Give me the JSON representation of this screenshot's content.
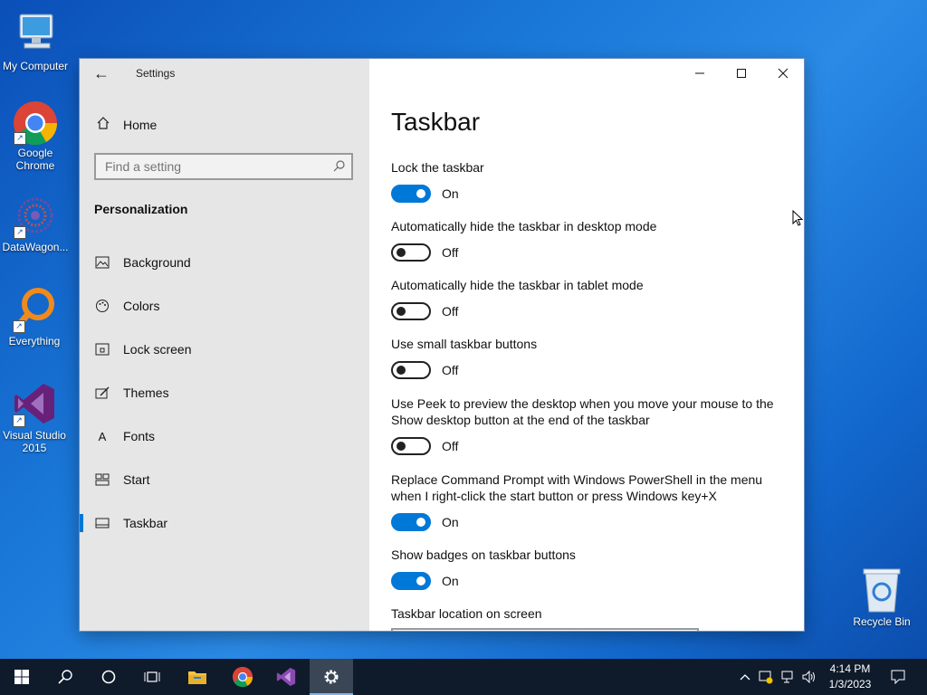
{
  "desktop": {
    "icons": [
      {
        "label": "My Computer"
      },
      {
        "label": "Google Chrome"
      },
      {
        "label": "DataWagon..."
      },
      {
        "label": "Everything"
      },
      {
        "label": "Visual Studio 2015"
      },
      {
        "label": "Recycle Bin"
      }
    ]
  },
  "window": {
    "title": "Settings",
    "controls": {
      "minimize": "—",
      "maximize": "☐",
      "close": "✕"
    }
  },
  "sidebar": {
    "home_label": "Home",
    "search_placeholder": "Find a setting",
    "section_title": "Personalization",
    "items": [
      {
        "label": "Background",
        "icon": "background-icon"
      },
      {
        "label": "Colors",
        "icon": "colors-icon"
      },
      {
        "label": "Lock screen",
        "icon": "lock-screen-icon"
      },
      {
        "label": "Themes",
        "icon": "themes-icon"
      },
      {
        "label": "Fonts",
        "icon": "fonts-icon"
      },
      {
        "label": "Start",
        "icon": "start-icon"
      },
      {
        "label": "Taskbar",
        "icon": "taskbar-icon",
        "active": true
      }
    ]
  },
  "main": {
    "page_title": "Taskbar",
    "settings": [
      {
        "label": "Lock the taskbar",
        "state": "On"
      },
      {
        "label": "Automatically hide the taskbar in desktop mode",
        "state": "Off"
      },
      {
        "label": "Automatically hide the taskbar in tablet mode",
        "state": "Off"
      },
      {
        "label": "Use small taskbar buttons",
        "state": "Off"
      },
      {
        "label": "Use Peek to preview the desktop when you move your mouse to the Show desktop button at the end of the taskbar",
        "state": "Off"
      },
      {
        "label": "Replace Command Prompt with Windows PowerShell in the menu when I right-click the start button or press Windows key+X",
        "state": "On"
      },
      {
        "label": "Show badges on taskbar buttons",
        "state": "On"
      }
    ],
    "location_label": "Taskbar location on screen"
  },
  "taskbar": {
    "clock_time": "4:14 PM",
    "clock_date": "1/3/2023"
  },
  "colors": {
    "accent": "#0078d7",
    "taskbar_bg": "#0f1a2b",
    "sidebar_bg": "#e6e6e6"
  }
}
